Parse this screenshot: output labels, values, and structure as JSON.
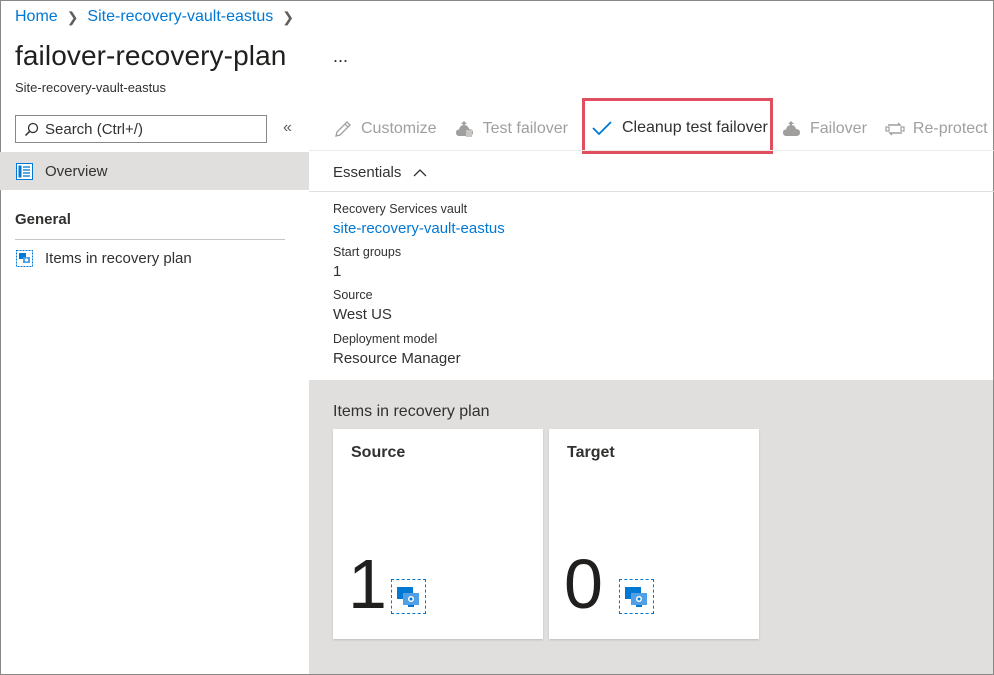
{
  "breadcrumb": {
    "home": "Home",
    "vault": "Site-recovery-vault-eastus"
  },
  "header": {
    "title": "failover-recovery-plan",
    "subtitle": "Site-recovery-vault-eastus",
    "more": "..."
  },
  "sidebar": {
    "search_placeholder": "Search (Ctrl+/)",
    "collapse": "«",
    "overview_label": "Overview",
    "section_general": "General",
    "items_label": "Items in recovery plan"
  },
  "toolbar": {
    "customize": "Customize",
    "test_failover": "Test failover",
    "cleanup_test_failover": "Cleanup test failover",
    "failover": "Failover",
    "reprotect": "Re-protect"
  },
  "essentials": {
    "title": "Essentials",
    "fields": [
      {
        "label": "Recovery Services vault",
        "value": "site-recovery-vault-eastus"
      },
      {
        "label": "Start groups",
        "value": "1"
      },
      {
        "label": "Source",
        "value": "West US"
      },
      {
        "label": "Deployment model",
        "value": "Resource Manager"
      }
    ]
  },
  "items_section": {
    "heading": "Items in recovery plan",
    "tiles": [
      {
        "title": "Source",
        "count": "1"
      },
      {
        "title": "Target",
        "count": "0"
      }
    ]
  },
  "colors": {
    "link": "#0078d4",
    "highlight_border": "#e04f5f",
    "disabled_text": "#a19f9d",
    "gray_area": "#e1dfdd"
  },
  "icons": [
    "search-icon",
    "overview-icon",
    "recovery-items-icon",
    "pencil-icon",
    "test-failover-icon",
    "checkmark-icon",
    "failover-icon",
    "reprotect-icon",
    "chevron-up-icon",
    "vm-icon"
  ]
}
